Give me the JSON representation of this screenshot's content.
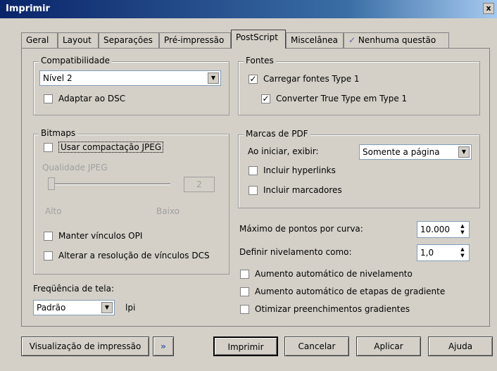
{
  "window": {
    "title": "Imprimir",
    "close": "x"
  },
  "tabs": [
    "Geral",
    "Layout",
    "Separações",
    "Pré-impressão",
    "PostScript",
    "Miscelânea",
    "Nenhuma questão"
  ],
  "compat": {
    "legend": "Compatibilidade",
    "level": "Nível 2",
    "dsc_label": "Adaptar ao DSC",
    "dsc_checked": false
  },
  "fonts": {
    "legend": "Fontes",
    "type1_label": "Carregar fontes Type 1",
    "type1_checked": true,
    "tt_label": "Converter True Type em Type 1",
    "tt_checked": true
  },
  "bitmaps": {
    "legend": "Bitmaps",
    "jpeg_label": "Usar compactação JPEG",
    "jpeg_checked": false,
    "quality_label": "Qualidade JPEG",
    "quality_value": "2",
    "quality_min": "Alto",
    "quality_max": "Baixo",
    "opi_label": "Manter vínculos OPI",
    "opi_checked": false,
    "dcs_label": "Alterar a resolução de vínculos DCS",
    "dcs_checked": false
  },
  "pdf": {
    "legend": "Marcas de PDF",
    "on_start_label": "Ao iniciar, exibir:",
    "on_start_value": "Somente a página",
    "hyperlinks_label": "Incluir hyperlinks",
    "hyperlinks_checked": false,
    "bookmarks_label": "Incluir marcadores",
    "bookmarks_checked": false
  },
  "curve": {
    "label": "Máximo de pontos por curva:",
    "value": "10.000"
  },
  "flatness": {
    "label": "Definir nivelamento como:",
    "value": "1,0"
  },
  "options": [
    {
      "label": "Aumento automático de nivelamento",
      "checked": false
    },
    {
      "label": "Aumento automático de etapas de gradiente",
      "checked": false
    },
    {
      "label": "Otimizar preenchimentos gradientes",
      "checked": false
    }
  ],
  "screen": {
    "label": "Freqüência de tela:",
    "value": "Padrão",
    "unit": "lpi"
  },
  "buttons": {
    "preview": "Visualização de impressão",
    "expand": "»",
    "print": "Imprimir",
    "cancel": "Cancelar",
    "apply": "Aplicar",
    "help": "Ajuda"
  }
}
